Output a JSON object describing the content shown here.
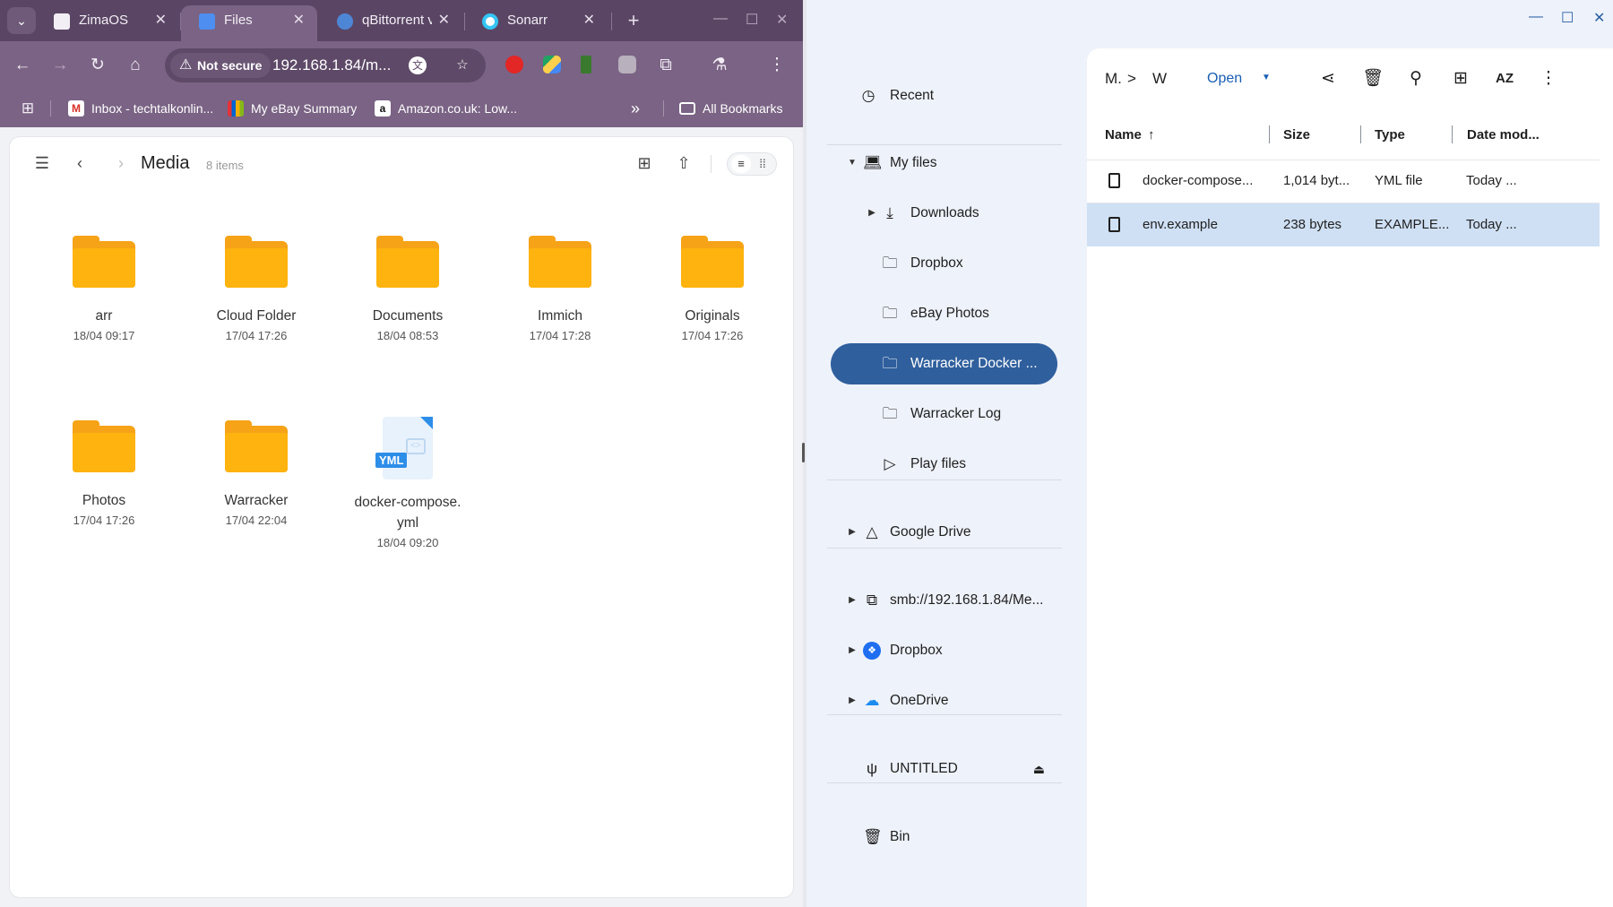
{
  "browser": {
    "tabs": [
      {
        "label": "ZimaOS",
        "active": false
      },
      {
        "label": "Files",
        "active": true
      },
      {
        "label": "qBittorrent v",
        "active": false
      },
      {
        "label": "Sonarr",
        "active": false
      }
    ],
    "omnibox": {
      "security": "Not secure",
      "url": "192.168.1.84/m..."
    },
    "bookmarks": [
      {
        "label": "Inbox - techtalkonlin..."
      },
      {
        "label": "My eBay Summary"
      },
      {
        "label": "Amazon.co.uk: Low..."
      }
    ],
    "all_bookmarks": "All Bookmarks",
    "overflow": "»"
  },
  "zima_files": {
    "title": "Media",
    "count": "8 items",
    "items": [
      {
        "name": "arr",
        "date": "18/04 09:17",
        "type": "folder"
      },
      {
        "name": "Cloud Folder",
        "date": "17/04 17:26",
        "type": "folder"
      },
      {
        "name": "Documents",
        "date": "18/04 08:53",
        "type": "folder"
      },
      {
        "name": "Immich",
        "date": "17/04 17:28",
        "type": "folder"
      },
      {
        "name": "Originals",
        "date": "17/04 17:26",
        "type": "folder"
      },
      {
        "name": "Photos",
        "date": "17/04 17:26",
        "type": "folder"
      },
      {
        "name": "Warracker",
        "date": "17/04 22:04",
        "type": "folder"
      },
      {
        "name": "docker-compose.\nyml",
        "date": "18/04 09:20",
        "type": "yml",
        "badge": "YML"
      }
    ]
  },
  "chromeos_files": {
    "sidebar": {
      "recent": "Recent",
      "my_files": "My files",
      "downloads": "Downloads",
      "dropbox_local": "Dropbox",
      "ebay_photos": "eBay Photos",
      "warracker_docker": "Warracker Docker ...",
      "warracker_log": "Warracker Log",
      "play_files": "Play files",
      "google_drive": "Google Drive",
      "smb": "smb://192.168.1.84/Me...",
      "dropbox": "Dropbox",
      "onedrive": "OneDrive",
      "untitled": "UNTITLED",
      "bin": "Bin"
    },
    "breadcrumb": {
      "first": "M.",
      "sep": ">",
      "second": "W"
    },
    "open_label": "Open",
    "columns": {
      "name": "Name",
      "size": "Size",
      "type": "Type",
      "date": "Date mod..."
    },
    "rows": [
      {
        "name": "docker-compose...",
        "size": "1,014 byt...",
        "type": "YML file",
        "date": "Today ...",
        "selected": false
      },
      {
        "name": "env.example",
        "size": "238 bytes",
        "type": "EXAMPLE...",
        "date": "Today ...",
        "selected": true
      }
    ]
  },
  "colors": {
    "accent": "#2f5f9d",
    "folder": "#ffb30f",
    "tabstrip": "#5a4664",
    "toolbar": "#7a6384"
  }
}
